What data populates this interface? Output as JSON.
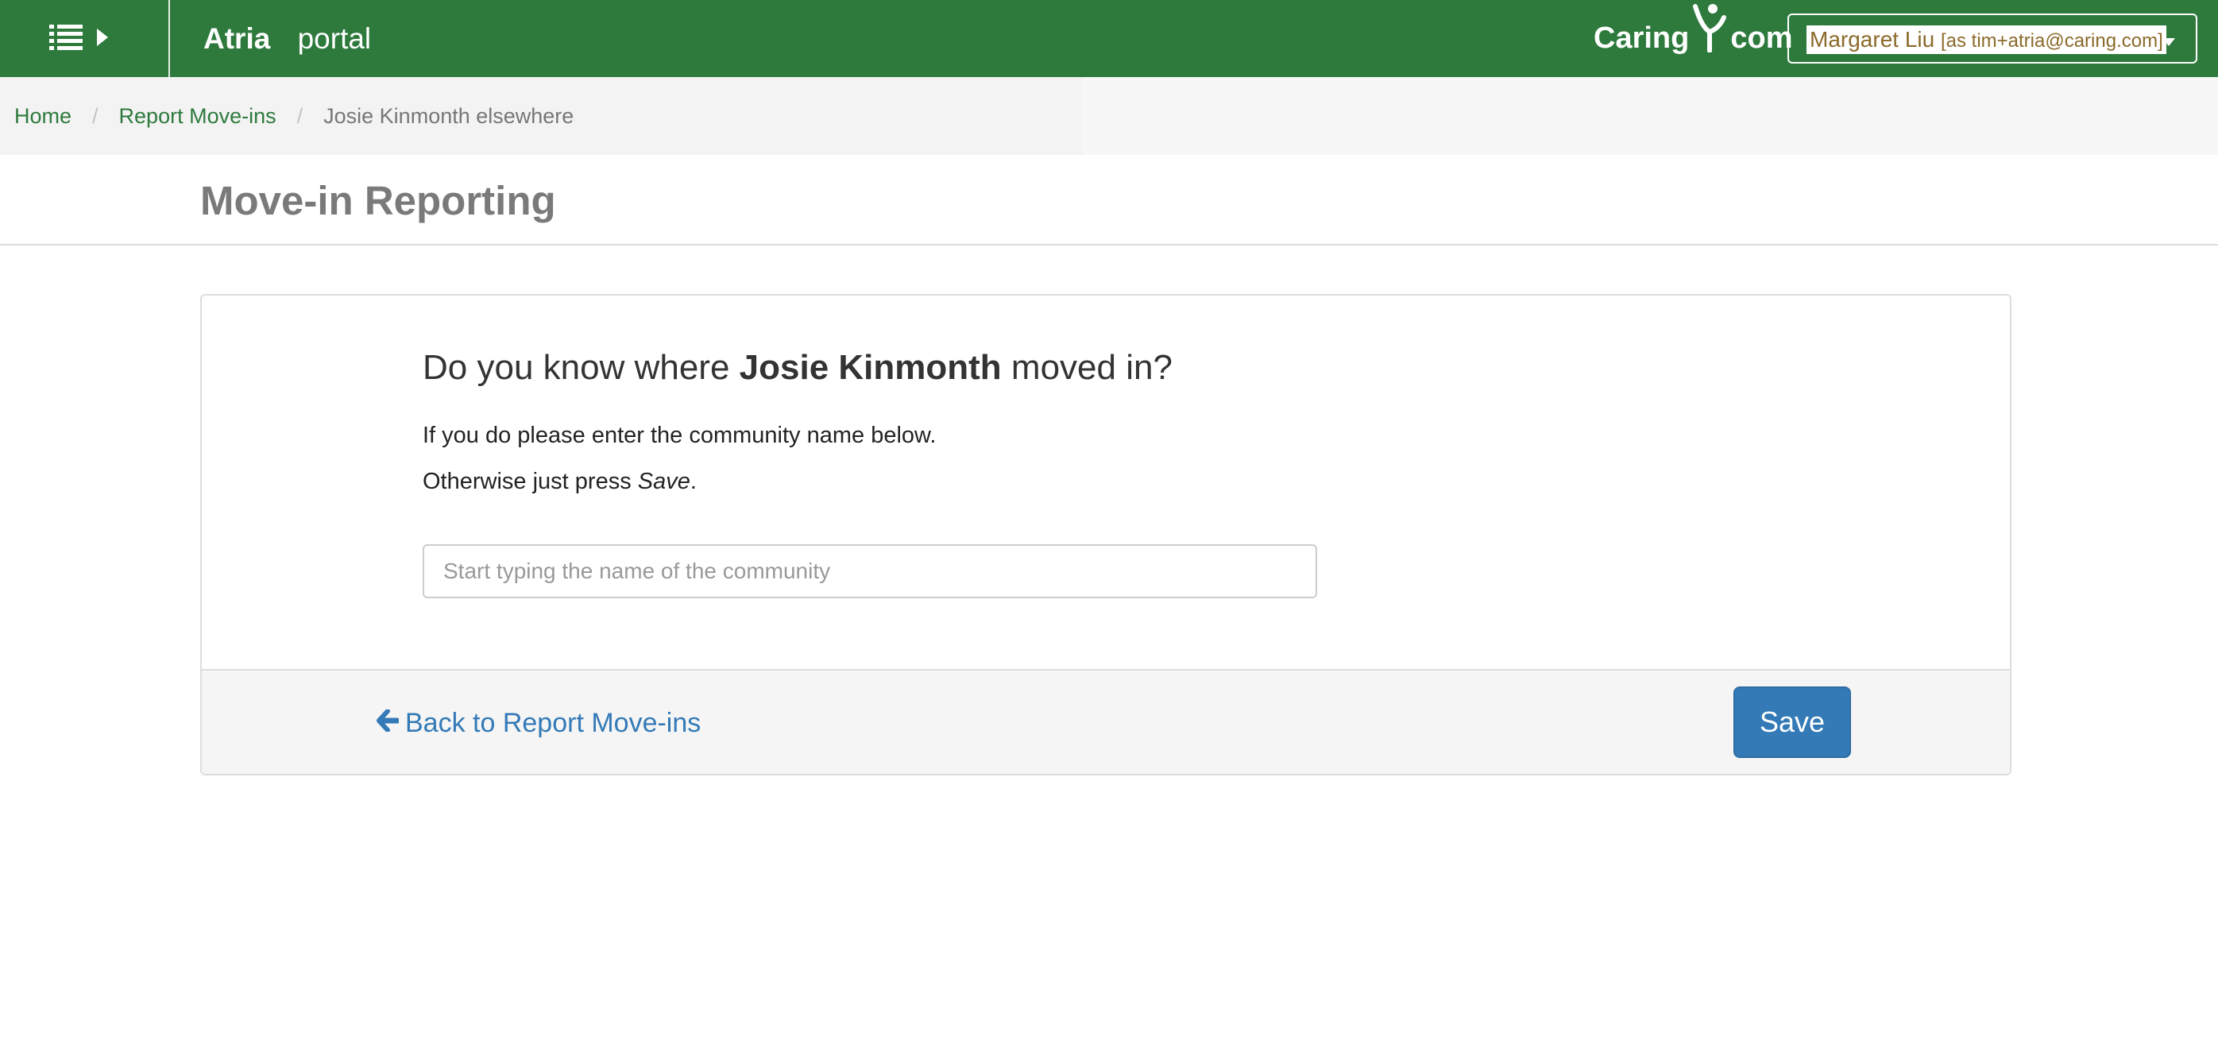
{
  "navbar": {
    "menu_icon": "list-icon",
    "menu_caret_icon": "caret-right-icon",
    "brand_name": "Atria",
    "brand_sub": "portal",
    "logo": {
      "text_left": "Caring",
      "text_right": "com",
      "mark_icon": "caring-person-icon"
    },
    "user": {
      "name": "Margaret Liu",
      "as_account": "[as tim+atria@caring.com]",
      "caret_icon": "caret-down-icon"
    },
    "background_color": "#2e7a3d"
  },
  "breadcrumb": {
    "items": [
      {
        "label": "Home"
      },
      {
        "label": "Report Move-ins"
      }
    ],
    "separator": "/",
    "current": "Josie Kinmonth elsewhere"
  },
  "page": {
    "title": "Move-in Reporting"
  },
  "panel": {
    "question_prefix": "Do you know where ",
    "person_name": "Josie Kinmonth",
    "question_suffix": " moved in?",
    "hint_line_1": "If you do please enter the community name below.",
    "hint_line_2_prefix": "Otherwise just press ",
    "hint_line_2_emphasis": "Save",
    "hint_line_2_suffix": ".",
    "community_input": {
      "value": "",
      "placeholder": "Start typing the name of the community"
    },
    "back_link_label": "Back to Report Move-ins",
    "back_icon": "arrow-left-icon",
    "save_label": "Save",
    "save_color": "#337ab7"
  }
}
